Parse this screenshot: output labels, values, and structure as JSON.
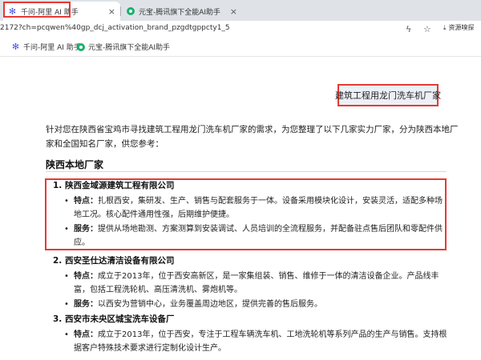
{
  "tabs": [
    {
      "title": "千问-阿里 AI 助手"
    },
    {
      "title": "元宝-腾讯旗下全能AI助手"
    }
  ],
  "address": {
    "url": "2172?ch=pcqwen%40gp_dcj_activation_brand_pzgdtgppcty1_5",
    "extension_label": "资源嗅探"
  },
  "bookmarks": [
    {
      "label": "千问-阿里 AI 助手"
    },
    {
      "label": "元宝-腾讯旗下全能AI助手"
    }
  ],
  "chat": {
    "user_message": "建筑工程用龙门洗车机厂家",
    "intro": "针对您在陕西省宝鸡市寻找建筑工程用龙门洗车机厂家的需求，为您整理了以下几家实力厂家，分为陕西本地厂家和全国知名厂家，供您参考：",
    "section_title": "陕西本地厂家",
    "companies": [
      {
        "title": "1. 陕西金域源建筑工程有限公司",
        "features_label": "特点：",
        "features": "扎根西安，集研发、生产、销售与配套服务于一体。设备采用模块化设计，安装灵活，适配多种场地工况。核心配件通用性强，后期维护便捷。",
        "service_label": "服务：",
        "service": "提供从场地勘测、方案测算到安装调试、人员培训的全流程服务，并配备驻点售后团队和零配件供应。"
      },
      {
        "title": "2. 西安圣仕达清洁设备有限公司",
        "features_label": "特点：",
        "features": "成立于2013年，位于西安高新区，是一家集组装、销售、维修于一体的清洁设备企业。产品线丰富，包括工程洗轮机、高压清洗机、雾炮机等。",
        "service_label": "服务：",
        "service": "以西安为营销中心，业务覆盖周边地区，提供完善的售后服务。"
      },
      {
        "title": "3. 西安市未央区城宝洗车设备厂",
        "features_label": "特点：",
        "features": "成立于2013年，位于西安，专注于工程车辆洗车机、工地洗轮机等系列产品的生产与销售。支持根据客户特殊技术要求进行定制化设计生产。"
      }
    ]
  }
}
